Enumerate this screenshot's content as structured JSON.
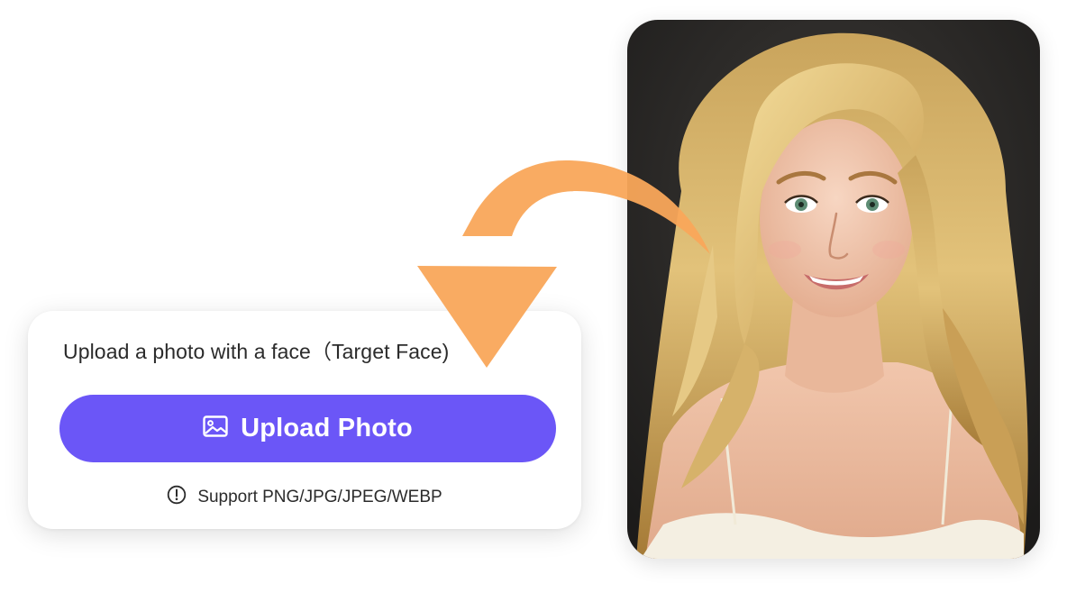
{
  "upload_panel": {
    "title": "Upload a photo with a face（Target Face)",
    "button_label": "Upload Photo",
    "button_icon": "image-icon",
    "support_icon": "info-circle-icon",
    "support_text": "Support PNG/JPG/JPEG/WEBP"
  },
  "preview": {
    "subject": "portrait photo of a smiling woman with long wavy blonde hair"
  },
  "colors": {
    "accent": "#6b56f7",
    "arrow": "#f9a65a",
    "text": "#2b2b2b"
  }
}
